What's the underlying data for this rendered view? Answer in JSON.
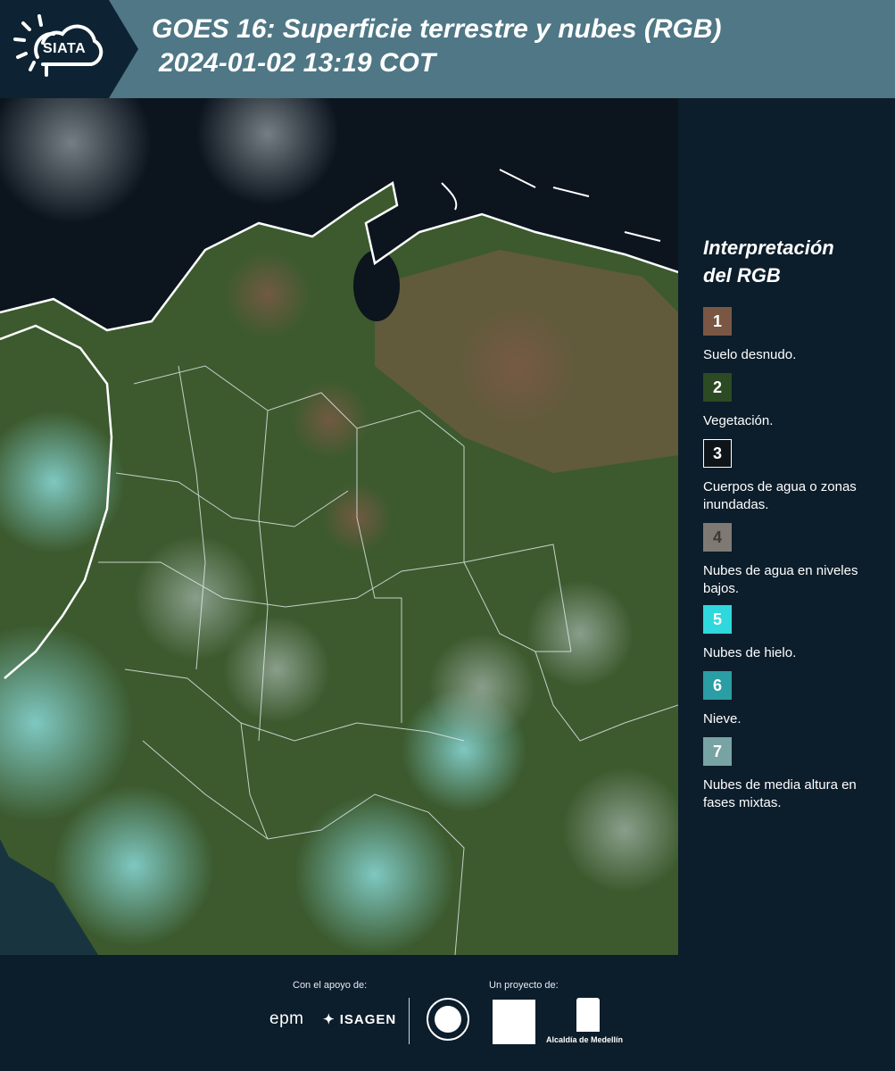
{
  "header": {
    "logo_text": "SIATA",
    "title_line1": "GOES 16: Superficie terrestre y nubes (RGB)",
    "title_line2": "2024-01-02 13:19 COT"
  },
  "legend": {
    "title_line1": "Interpretación",
    "title_line2": "del RGB",
    "items": [
      {
        "number": "1",
        "label": "Suelo desnudo.",
        "color": "#7a5744"
      },
      {
        "number": "2",
        "label": "Vegetación.",
        "color": "#2c4a24"
      },
      {
        "number": "3",
        "label": "Cuerpos de agua o zonas inundadas.",
        "color": "#0e1418"
      },
      {
        "number": "4",
        "label": "Nubes de agua en niveles bajos.",
        "color": "#7e7a73"
      },
      {
        "number": "5",
        "label": "Nubes de hielo.",
        "color": "#2fd8dd"
      },
      {
        "number": "6",
        "label": "Nieve.",
        "color": "#2a9ea4"
      },
      {
        "number": "7",
        "label": "Nubes de media altura en fases mixtas.",
        "color": "#78a3a4"
      }
    ]
  },
  "footer": {
    "support_label": "Con el apoyo de:",
    "project_label": "Un proyecto de:",
    "epm": "epm",
    "isagen": "ISAGEN",
    "alcaldia": "Alcaldía de Medellín"
  }
}
